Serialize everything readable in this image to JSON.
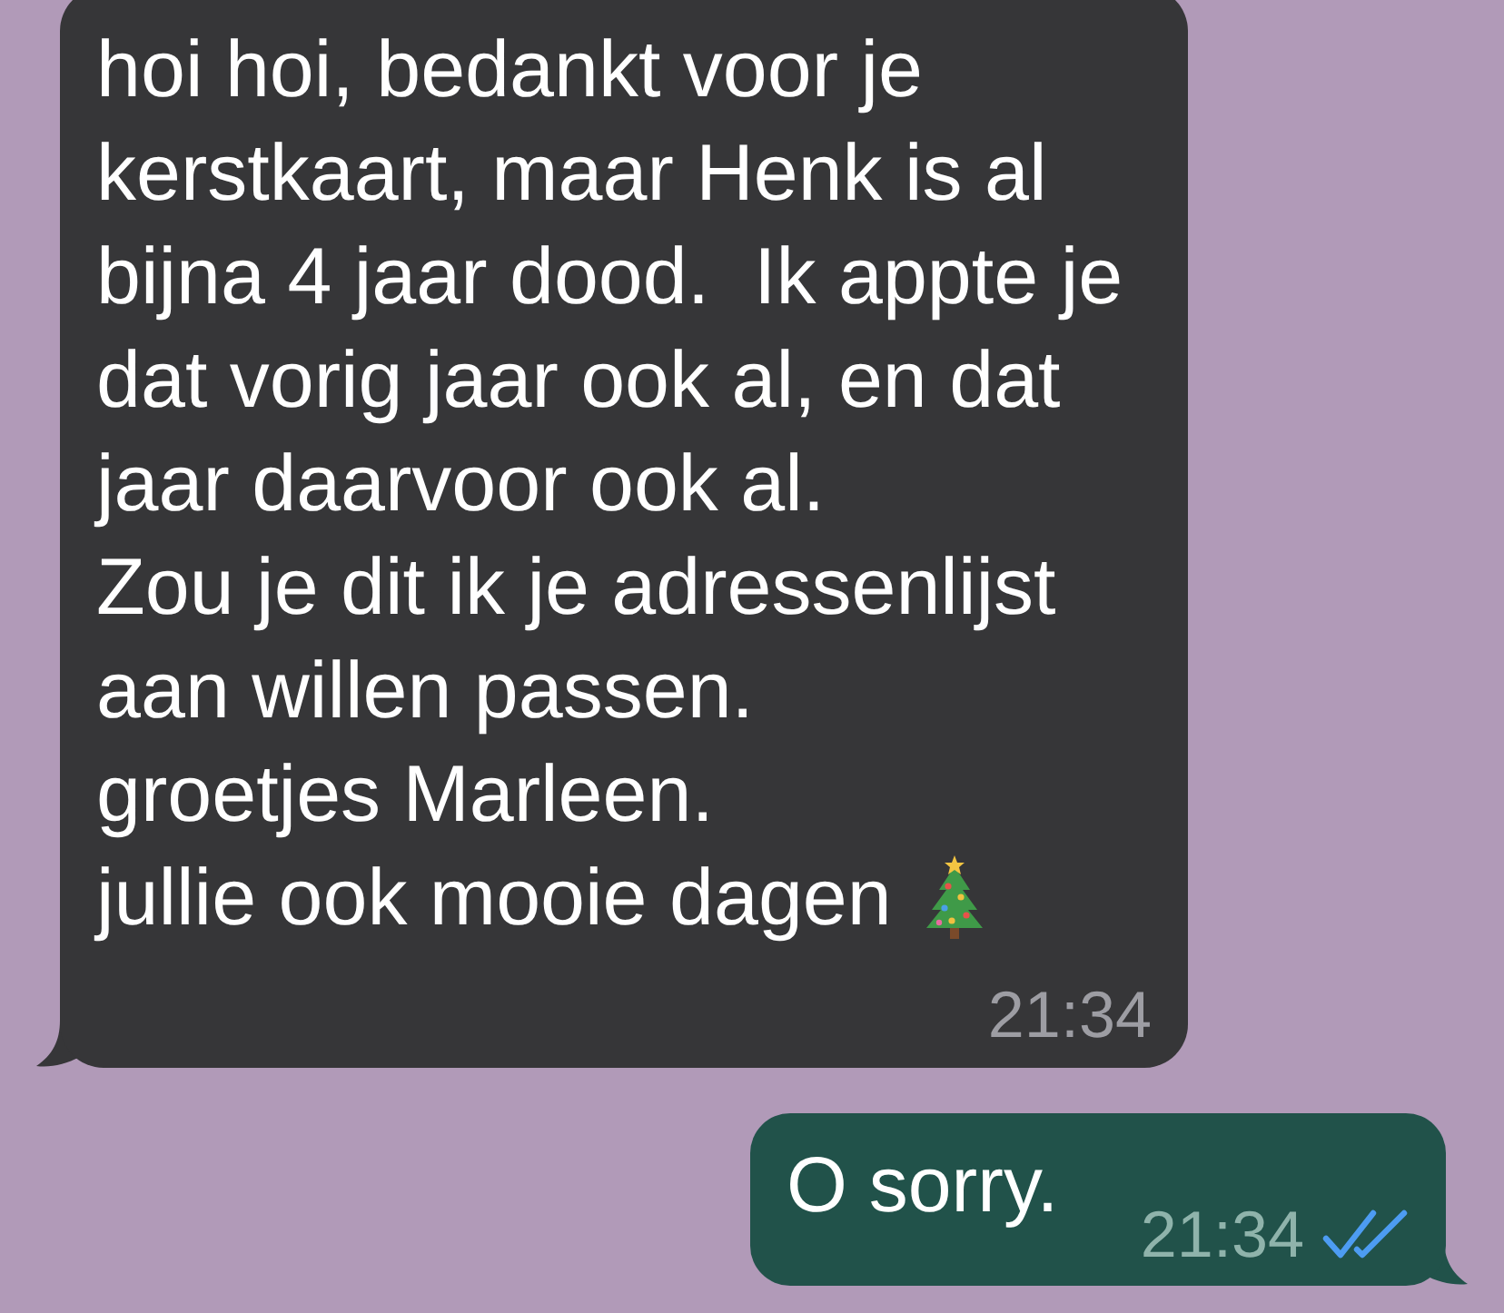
{
  "messages": [
    {
      "kind": "incoming",
      "paragraphs": [
        "hoi hoi, bedankt voor je kerstkaart, maar Henk is al bijna 4 jaar dood.  Ik appte je dat vorig jaar ook al, en dat jaar daarvoor ook al.",
        "Zou je dit ik je adressenlijst aan willen passen.",
        "groetjes Marleen.",
        "jullie ook mooie dagen"
      ],
      "has_emoji": true,
      "time": "21:34"
    },
    {
      "kind": "outgoing",
      "paragraphs": [
        "O sorry."
      ],
      "time": "21:34",
      "read": true
    }
  ]
}
